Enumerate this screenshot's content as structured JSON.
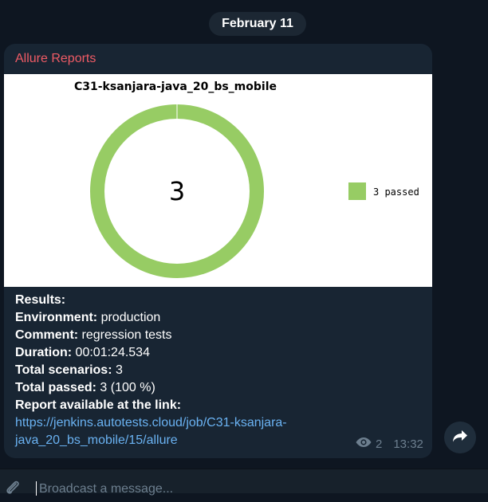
{
  "date_divider": "February 11",
  "message": {
    "sender": "Allure Reports",
    "chart_data": {
      "type": "pie",
      "title": "C31-ksanjara-java_20_bs_mobile",
      "center_label": "3",
      "slices": [
        {
          "name": "3 passed",
          "value": 3,
          "color": "#97cc64"
        }
      ],
      "legend_position": "right"
    },
    "lines": [
      {
        "label": "Results:",
        "value": ""
      },
      {
        "label": "Environment:",
        "value": " production"
      },
      {
        "label": "Comment:",
        "value": " regression tests"
      },
      {
        "label": "Duration:",
        "value": " 00:01:24.534"
      },
      {
        "label": "Total scenarios:",
        "value": " 3"
      },
      {
        "label": "Total passed:",
        "value": " 3 (100 %)"
      },
      {
        "label": "Report available at the link:",
        "value": ""
      }
    ],
    "link_lines": [
      "https://jenkins.autotests.cloud/job/C31-ksanjara-",
      "java_20_bs_mobile/15/allure"
    ],
    "views": "2",
    "time": "13:32"
  },
  "composer": {
    "placeholder": "Broadcast a message..."
  },
  "colors": {
    "background": "#0e1621",
    "bubble": "#182533",
    "sender": "#ef5b65",
    "link": "#6ab2f2",
    "passed": "#97cc64"
  },
  "icons": {
    "views": "eye-icon",
    "share": "share-arrow-icon",
    "attach": "paperclip-icon"
  }
}
